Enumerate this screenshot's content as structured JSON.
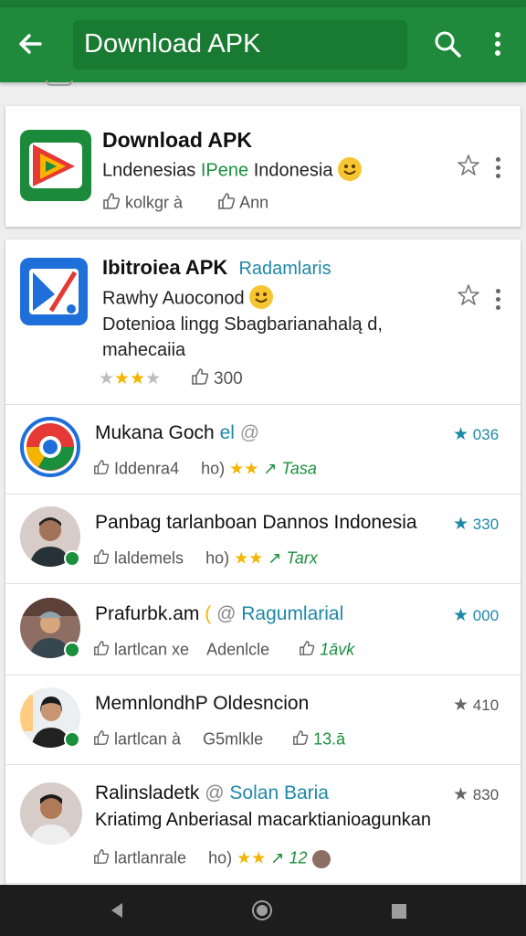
{
  "app_bar": {
    "title": "Download APK",
    "back_icon": "arrow-back-icon",
    "search_icon": "search-icon",
    "more_icon": "more-vert-icon",
    "color": "#1f8a3b"
  },
  "top_card": {
    "title": "Download APK",
    "subtitle_part1": "Lndenesias",
    "subtitle_part2": "IPene",
    "subtitle_part3": "Indonesia",
    "like_label": "kolkgr à",
    "second_label": "Ann"
  },
  "featured": {
    "title": "Ibitroiea APK",
    "tag": "Radamlaris",
    "line1": "Rawhy Auoconod",
    "line2": "Dotenioa lingg Sbagbarianahalą d,",
    "line3": "mahecaiia",
    "likes": "300",
    "stars": 2.5
  },
  "list_items": [
    {
      "title": "Mukana Goch",
      "title_extra": "el",
      "rating": "036",
      "meta1": "Iddenra4",
      "meta2": "ho)",
      "extra": "Tasa"
    },
    {
      "title": "Panbag tarlanboan Dannos Indonesia",
      "title_extra": "",
      "rating": "330",
      "meta1": "laldemels",
      "meta2": "ho)",
      "extra": "Tarx"
    },
    {
      "title": "Prafurbk.am",
      "title_extra": "Ragumlarial",
      "rating": "000",
      "meta1": "lartlcan xe",
      "meta2": "Adenlcle",
      "extra": "1āvk"
    },
    {
      "title": "MemnlondhP",
      "title_extra": "Oldesncion",
      "rating": "410",
      "meta1": "lartlcan à",
      "meta2": "G5mlkle",
      "extra": "13.ā"
    },
    {
      "title": "Ralinsladetk",
      "title_extra": "Solan Baria",
      "subtitle": "Kriatimg Anberiasal macarktianioagunkan",
      "rating": "830",
      "meta1": "lartlanrale",
      "meta2": "ho)",
      "extra": "12"
    }
  ],
  "nav_bar": {
    "back_icon": "nav-back-icon",
    "home_icon": "nav-home-icon",
    "recents_icon": "nav-recents-icon"
  },
  "colors": {
    "accent_green": "#1f8a3b",
    "teal": "#1e88a8",
    "star_gold": "#f4b400"
  }
}
